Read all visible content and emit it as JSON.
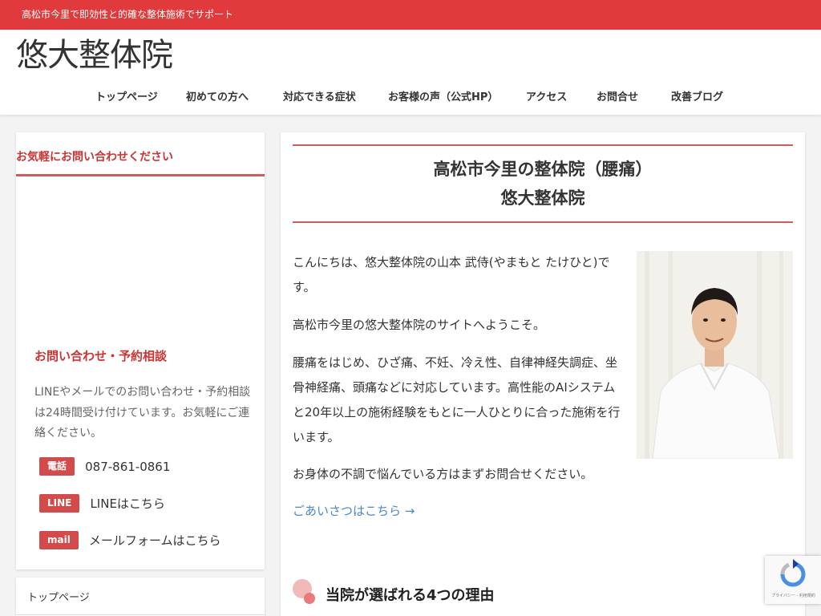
{
  "topbar": {
    "tagline": "高松市今里で即効性と的確な整体施術でサポート"
  },
  "header": {
    "site_title": "悠大整体院"
  },
  "nav": {
    "items": [
      {
        "label": "トップページ"
      },
      {
        "label": "初めての方へ"
      },
      {
        "label": "対応できる症状"
      },
      {
        "label": "お客様の声（公式HP）"
      },
      {
        "label": "アクセス"
      },
      {
        "label": "お問合せ"
      },
      {
        "label": "改善ブログ"
      }
    ]
  },
  "sidebar": {
    "heading": "お気軽にお問い合わせください",
    "subheading": "お問い合わせ・予約相談",
    "description": "LINEやメールでのお問い合わせ・予約相談は24時間受け付けています。お気軽にご連絡ください。",
    "contacts": [
      {
        "tag": "電話",
        "text": "087-861-0861"
      },
      {
        "tag": "LINE",
        "text": "LINEはこちら"
      },
      {
        "tag": "mail",
        "text": "メールフォームはこちら"
      }
    ],
    "menu_item": "トップページ"
  },
  "main": {
    "title_line1": "高松市今里の整体院（腰痛）",
    "title_line2": "悠大整体院",
    "paragraphs": [
      "こんにちは、悠大整体院の山本 武侍(やまもと たけひと)です。",
      "高松市今里の悠大整体院のサイトへようこそ。",
      "腰痛をはじめ、ひざ痛、不妊、冷え性、自律神経失調症、坐骨神経痛、頭痛などに対応しています。高性能のAIシステムと20年以上の施術経験をもとに一人ひとりに合った施術を行います。",
      "お身体の不調で悩んでいる方はまずお問合せください。"
    ],
    "greeting_link": "ごあいさつはこちら →",
    "section_title": "当院が選ばれる4つの理由"
  },
  "recaptcha": {
    "label": "プライバシー - 利用規約"
  },
  "colors": {
    "accent": "#e03a3c",
    "tag": "#d24a4a",
    "link": "#4a86c8"
  }
}
